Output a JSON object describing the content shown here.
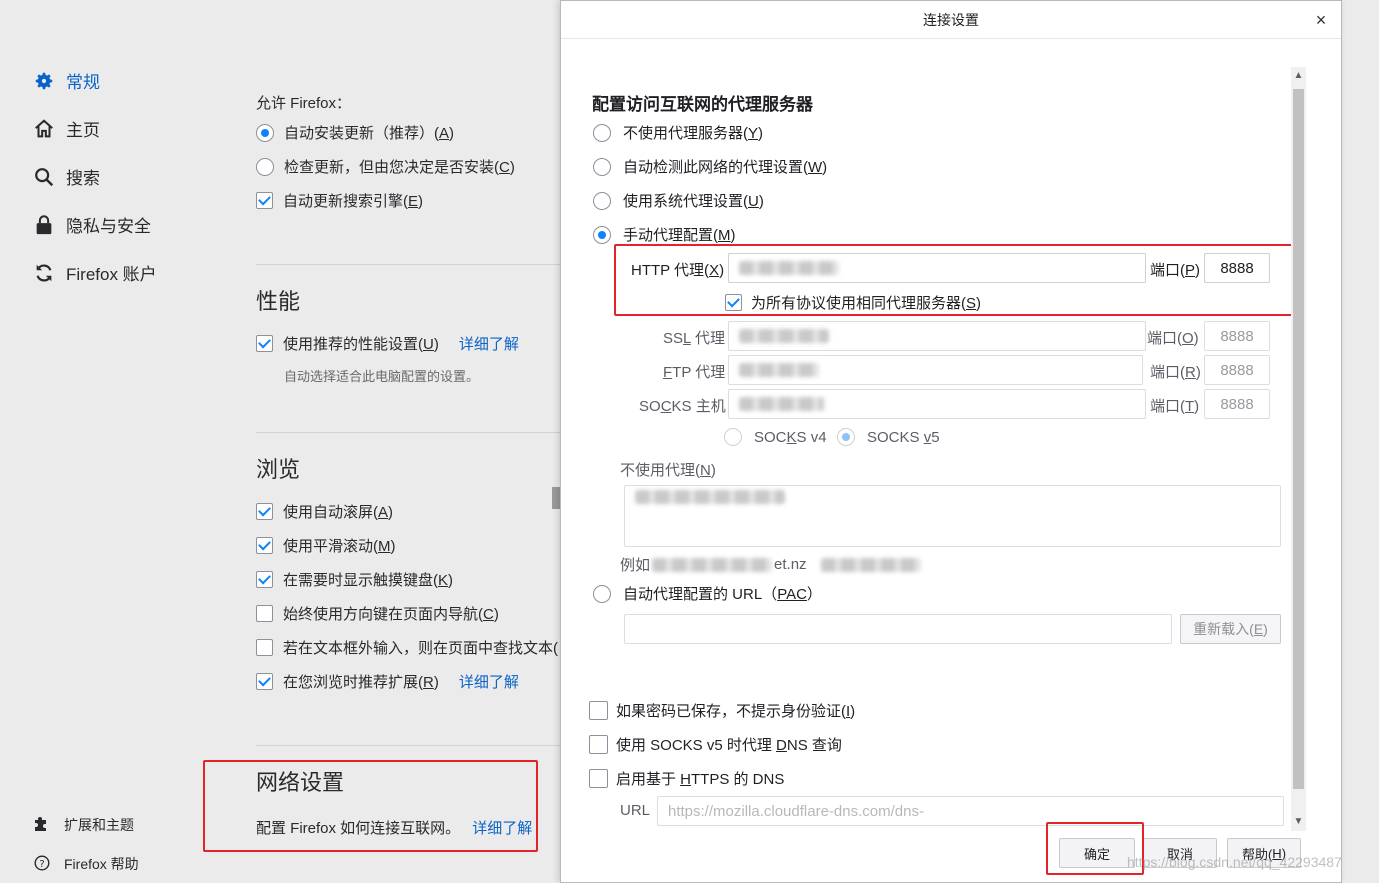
{
  "dialog": {
    "title": "连接设置",
    "close": "×",
    "heading": "配置访问互联网的代理服务器",
    "proxy_options": [
      {
        "label": "不使用代理服务器(",
        "key": "Y",
        "selected": false
      },
      {
        "label": "自动检测此网络的代理设置(",
        "key": "W",
        "selected": false
      },
      {
        "label": "使用系统代理设置(",
        "key": "U",
        "selected": false
      },
      {
        "label": "手动代理配置(",
        "key": "M",
        "selected": true
      }
    ],
    "http": {
      "label_a": "HTTP 代理(",
      "key": "X",
      "port_label": "端口(",
      "port_key": "P",
      "port": "8888"
    },
    "same_proxy": {
      "label": "为所有协议使用相同代理服务器(",
      "key": "S",
      "checked": true
    },
    "ssl": {
      "label_pre": "SS",
      "label_key": "L",
      "label_post": " 代理",
      "port_label": "端口(",
      "port_key": "O",
      "port": "8888"
    },
    "ftp": {
      "label_key": "F",
      "label_post": "TP 代理",
      "port_label": "端口(",
      "port_key": "R",
      "port": "8888"
    },
    "socks": {
      "label_pre": "SO",
      "label_key": "C",
      "label_post": "KS 主机",
      "port_label": "端口(",
      "port_key": "T",
      "port": "8888"
    },
    "socks_v4": {
      "pre": "SOC",
      "key": "K",
      "post": "S v4",
      "selected": false
    },
    "socks_v5": {
      "pre": "SOCKS ",
      "key": "v",
      "post": "5",
      "selected": true
    },
    "no_proxy": {
      "label": "不使用代理(",
      "key": "N"
    },
    "example": {
      "prefix": "例如 ",
      "visible": "et.nz"
    },
    "pac": {
      "label": "自动代理配置的 URL（",
      "key": "PAC",
      "post": "）",
      "selected": false,
      "reload_label": "重新载入(",
      "reload_key": "E"
    },
    "no_auth": {
      "label": "如果密码已保存，不提示身份验证(",
      "key": "I",
      "checked": false
    },
    "socks_dns": {
      "label_pre": "使用 SOCKS v5 时代理 ",
      "key": "D",
      "label_post": "NS 查询",
      "checked": false
    },
    "https_dns": {
      "label_pre": "启用基于 ",
      "key": "H",
      "label_post": "TTPS 的 DNS",
      "checked": false
    },
    "url": {
      "label": "URL",
      "value": "https://mozilla.cloudflare-dns.com/dns-"
    },
    "buttons": {
      "ok": "确定",
      "cancel": "取消",
      "help_pre": "帮助(",
      "help_key": "H",
      "close_paren": ")"
    }
  },
  "sidebar": {
    "items": [
      {
        "label": "常规",
        "icon": "gear-icon",
        "active": true
      },
      {
        "label": "主页",
        "icon": "home-icon",
        "active": false
      },
      {
        "label": "搜索",
        "icon": "search-icon",
        "active": false
      },
      {
        "label": "隐私与安全",
        "icon": "lock-icon",
        "active": false
      },
      {
        "label": "Firefox 账户",
        "icon": "sync-icon",
        "active": false
      }
    ],
    "bottom": [
      {
        "label": "扩展和主题",
        "icon": "puzzle-icon"
      },
      {
        "label": "Firefox 帮助",
        "icon": "help-icon"
      }
    ]
  },
  "general": {
    "allow_label": "允许 Firefox：",
    "updates": [
      {
        "label": "自动安装更新（推荐）(",
        "key": "A",
        "selected": true
      },
      {
        "label": "检查更新，但由您决定是否安装(",
        "key": "C",
        "selected": false
      }
    ],
    "auto_search": {
      "label": "自动更新搜索引擎(",
      "key": "E",
      "checked": true
    }
  },
  "performance": {
    "title": "性能",
    "recommended": {
      "label": "使用推荐的性能设置(",
      "key": "U",
      "checked": true
    },
    "learn_more": "详细了解",
    "hint": "自动选择适合此电脑配置的设置。"
  },
  "browsing": {
    "title": "浏览",
    "items": [
      {
        "label": "使用自动滚屏(",
        "key": "A",
        "checked": true,
        "link": ""
      },
      {
        "label": "使用平滑滚动(",
        "key": "M",
        "checked": true,
        "link": ""
      },
      {
        "label": "在需要时显示触摸键盘(",
        "key": "K",
        "checked": true,
        "link": ""
      },
      {
        "label": "始终使用方向键在页面内导航(",
        "key": "C",
        "checked": false,
        "link": ""
      },
      {
        "label": "若在文本框外输入，则在页面中查找文本(",
        "key": "",
        "checked": false,
        "link": ""
      },
      {
        "label": "在您浏览时推荐扩展(",
        "key": "R",
        "checked": true,
        "link": "详细了解"
      }
    ]
  },
  "network": {
    "title": "网络设置",
    "desc": "配置 Firefox 如何连接互联网。",
    "learn_more": "详细了解"
  },
  "watermark": "https://blog.csdn.net/qq_42293487",
  "colors": {
    "accent": "#0a84ff",
    "link": "#0a63c9",
    "highlight": "#e3242b"
  }
}
